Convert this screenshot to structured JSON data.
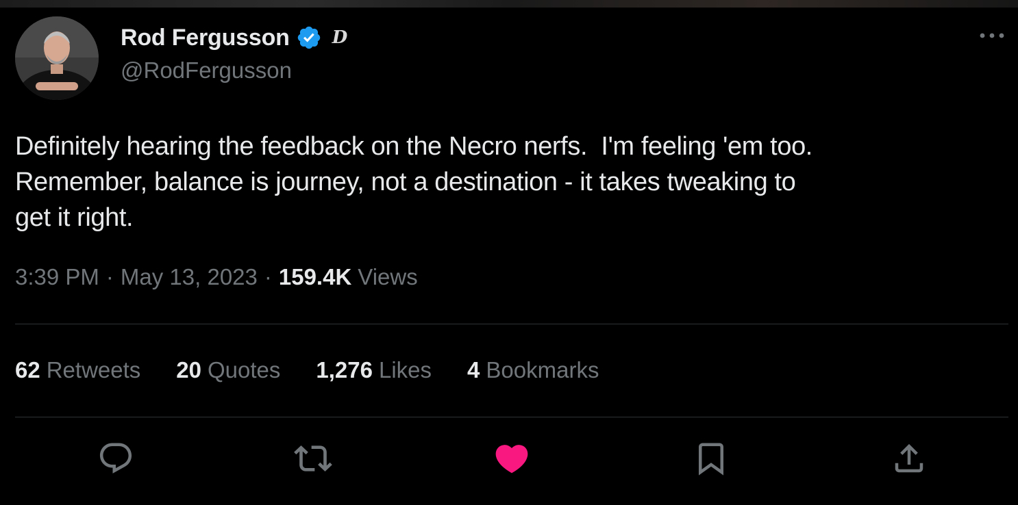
{
  "author": {
    "display_name": "Rod Fergusson",
    "handle": "@RodFergusson",
    "affiliate_badge": "D",
    "verified": true
  },
  "tweet": {
    "text": "Definitely hearing the feedback on the Necro nerfs.  I'm feeling 'em too.\nRemember, balance is journey, not a destination - it takes tweaking to\nget it right.",
    "time": "3:39 PM",
    "separator": "·",
    "date": "May 13, 2023",
    "views_count": "159.4K",
    "views_label": "Views"
  },
  "stats": [
    {
      "count": "62",
      "label": "Retweets"
    },
    {
      "count": "20",
      "label": "Quotes"
    },
    {
      "count": "1,276",
      "label": "Likes"
    },
    {
      "count": "4",
      "label": "Bookmarks"
    }
  ],
  "actions": [
    {
      "icon": "reply-icon"
    },
    {
      "icon": "retweet-icon"
    },
    {
      "icon": "like-icon",
      "state": "liked"
    },
    {
      "icon": "bookmark-icon"
    },
    {
      "icon": "share-icon"
    }
  ],
  "colors": {
    "background": "#000000",
    "text": "#e7e9ea",
    "secondary": "#71767b",
    "divider": "#2f3336",
    "verified": "#1d9bf0",
    "liked": "#f91880"
  }
}
